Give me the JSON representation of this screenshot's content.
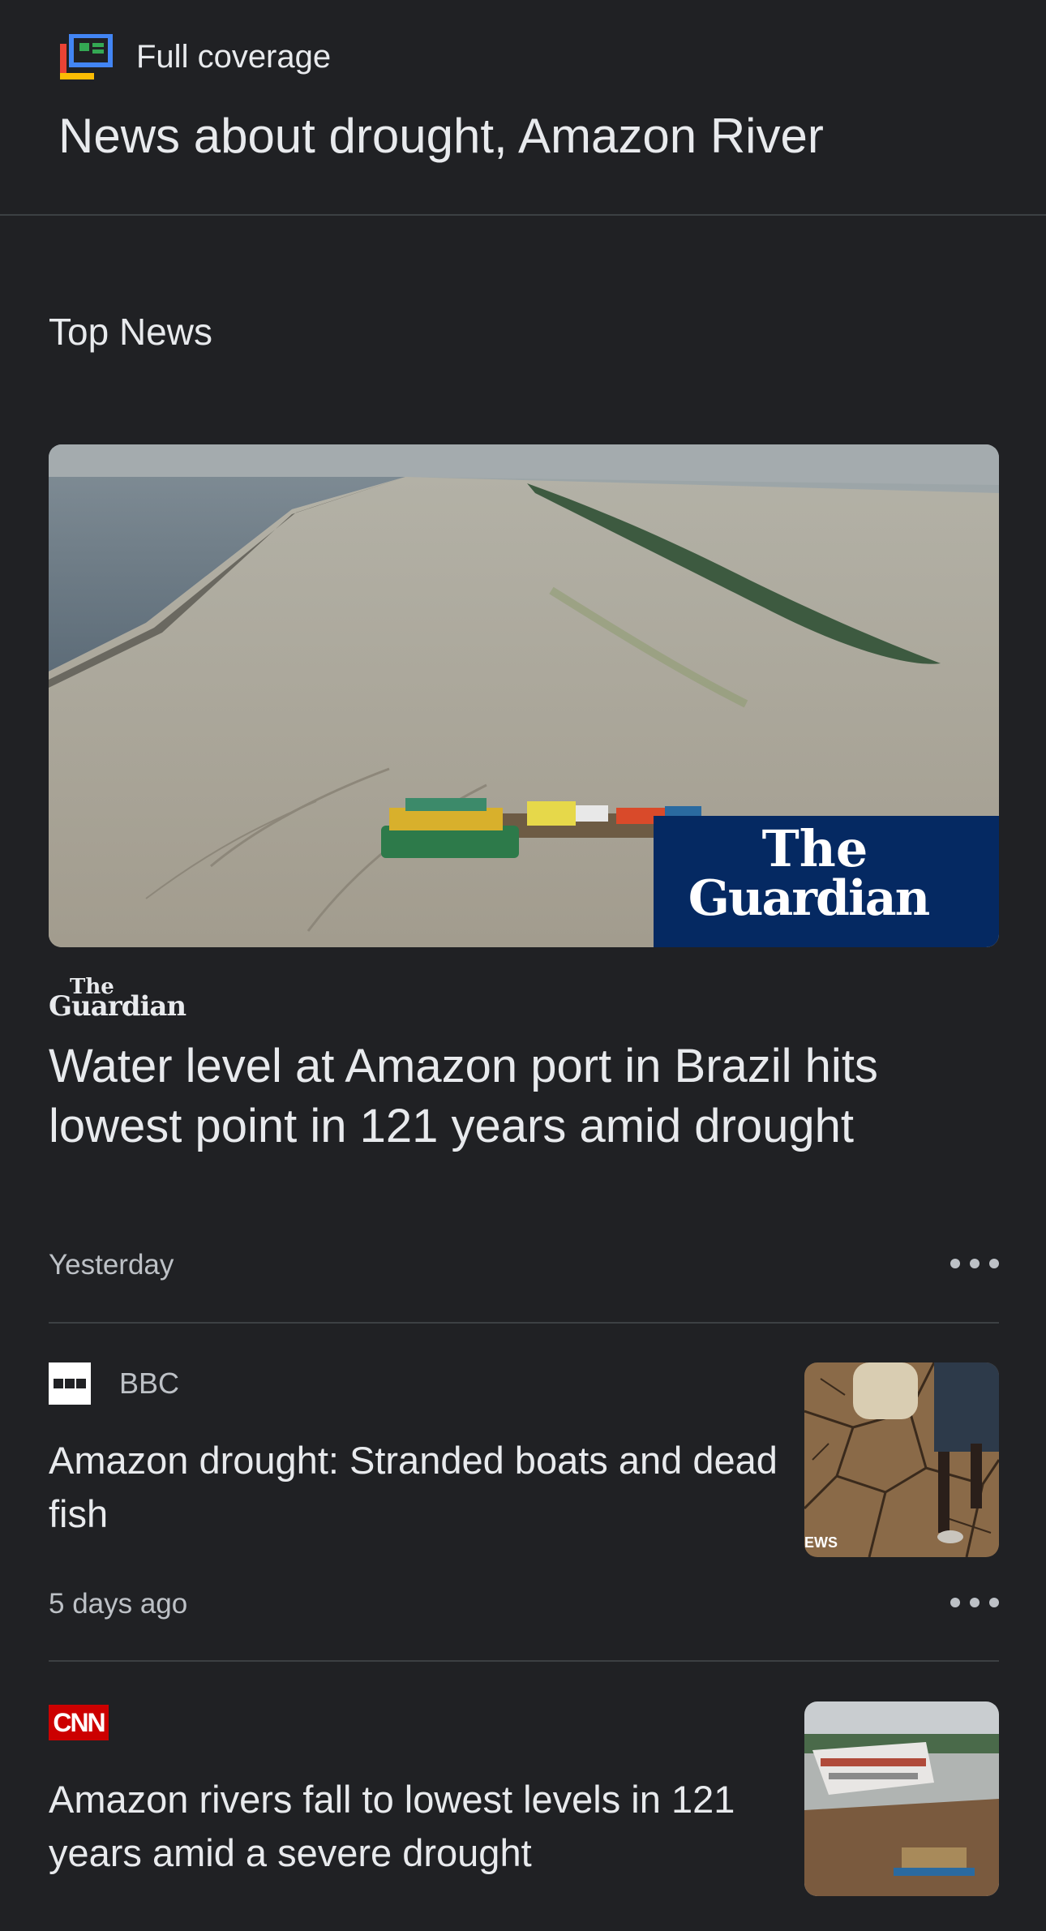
{
  "header": {
    "label": "Full coverage",
    "title": "News about drought, Amazon River"
  },
  "section": {
    "title": "Top News"
  },
  "hero_story": {
    "image_overlay": {
      "line1": "The",
      "line2": "Guardian"
    },
    "source_logo": {
      "line1": "The",
      "line2": "Guardian"
    },
    "headline": "Water level at Amazon port in Brazil hits lowest point in 121 years amid drought",
    "time": "Yesterday"
  },
  "stories": [
    {
      "source": "BBC",
      "source_logo_text": "BBC",
      "headline": "Amazon drought: Stranded boats and dead fish",
      "time": "5 days ago",
      "thumb_overlay": "EWS"
    },
    {
      "source_logo_text": "CNN",
      "headline": "Amazon rivers fall to lowest levels in 121 years amid a severe drought"
    }
  ],
  "colors": {
    "background": "#202124",
    "text_primary": "#e8eaed",
    "text_secondary": "#bdc1c6",
    "divider": "#3c4043",
    "guardian_blue": "#052962",
    "cnn_red": "#cc0000"
  },
  "icons": {
    "full_coverage": "full-coverage-icon",
    "more": "more-horizontal-icon"
  }
}
